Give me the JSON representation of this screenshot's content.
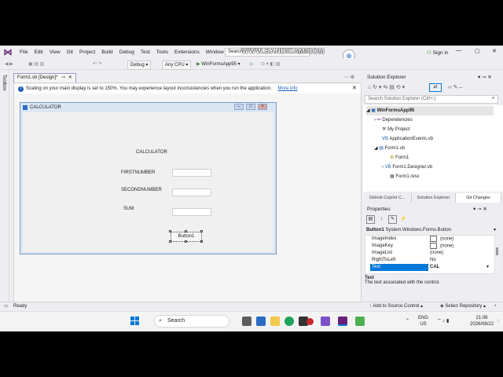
{
  "titlebar": {
    "menu": [
      "File",
      "Edit",
      "View",
      "Git",
      "Project",
      "Build",
      "Debug",
      "Test",
      "Tools",
      "Extensions",
      "Window"
    ],
    "search_text": "Search",
    "project_badge": "App95",
    "watermark": "WWW.BANDICAM.COM",
    "sign_in": "Sign in",
    "minimize": "—",
    "maximize": "▢",
    "close": "✕"
  },
  "toolbar": {
    "config": "Debug",
    "platform": "Any CPU",
    "run_target": "WinFormsApp95"
  },
  "toolbox_label": "Toolbox",
  "document": {
    "tab_label": "Form1.vb [Design]*",
    "info_message": "Scaling on your main display is set to 150%. You may experience layout inconsistencies when you run the application.",
    "info_link": "More info"
  },
  "form": {
    "title": "CALCULATOR",
    "heading": "CALCULATOR",
    "label_first": "FIRSTNUMBER",
    "label_second": "SECONDNUMBER",
    "label_sum": "SUM",
    "button_text": "Button1"
  },
  "solution_explorer": {
    "title": "Solution Explorer",
    "search_placeholder": "Search Solution Explorer (Ctrl+;)",
    "tree": [
      "WinFormsApp95",
      "Dependencies",
      "My Project",
      "ApplicationEvents.vb",
      "Form1.vb",
      "Form1",
      "Form1.Designer.vb",
      "Form1.resx"
    ]
  },
  "panel_tabs": [
    "GitHub Copilot C...",
    "Solution Explorer",
    "Git Changes"
  ],
  "properties": {
    "title": "Properties",
    "object": "Button1",
    "object_type": "System.Windows.Forms.Button",
    "rows": [
      {
        "name": "ImageIndex",
        "value": "(none)"
      },
      {
        "name": "ImageKey",
        "value": "(none)"
      },
      {
        "name": "ImageList",
        "value": "(none)"
      },
      {
        "name": "RightToLeft",
        "value": "No"
      },
      {
        "name": "Text",
        "value": "CAL"
      }
    ],
    "desc_title": "Text",
    "desc_text": "The text associated with the control."
  },
  "statusbar": {
    "ready": "Ready",
    "add_source": "Add to Source Control",
    "select_repo": "Select Repository"
  },
  "taskbar": {
    "search": "Search",
    "lang_top": "ENG",
    "lang_bottom": "US",
    "time": "21:06",
    "date": "2026/08/22"
  }
}
